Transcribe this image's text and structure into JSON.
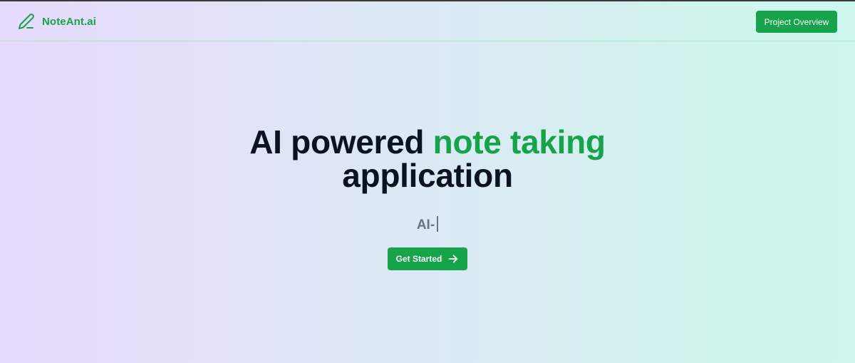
{
  "header": {
    "brand_name": "NoteAnt.ai",
    "brand_icon": "pencil-icon",
    "project_overview_label": "Project Overview"
  },
  "hero": {
    "title_part1": "AI powered ",
    "title_accent": "note taking",
    "title_part2": "application",
    "typing_text": "AI-",
    "cta_label": "Get Started",
    "cta_icon": "arrow-right-icon"
  },
  "colors": {
    "accent": "#16a34a",
    "title": "#0b1220",
    "muted": "#6b7280",
    "bg_left": "#e6dafc",
    "bg_right": "#cdf7ef"
  }
}
